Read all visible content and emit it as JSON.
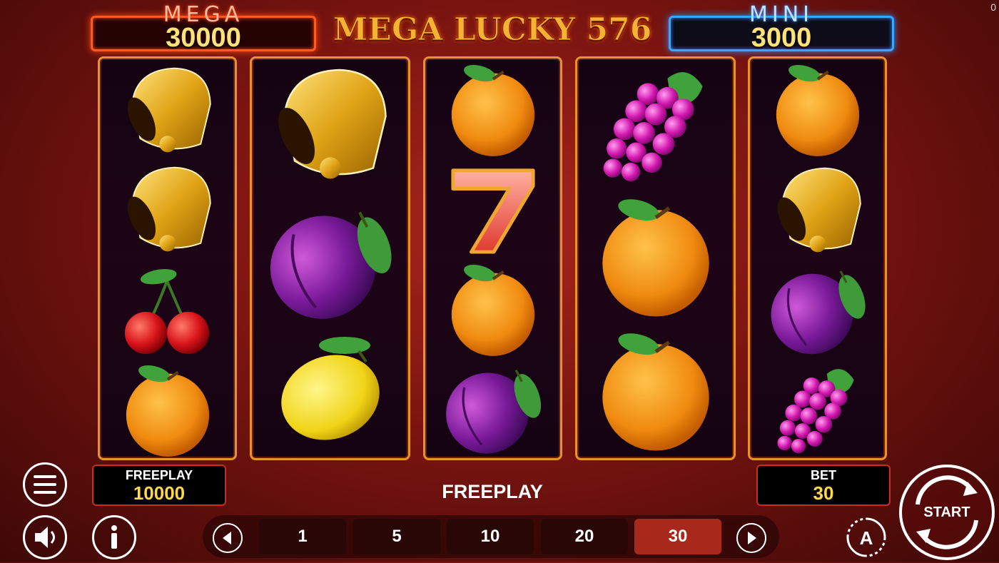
{
  "jackpots": {
    "mega": {
      "label": "MEGA",
      "value": "30000"
    },
    "mini": {
      "label": "MINI",
      "value": "3000"
    }
  },
  "game_title": "MEGA LUCKY 576",
  "corner_counter": "0",
  "reels": [
    [
      "bell-icon",
      "bell-icon",
      "cherry-icon",
      "orange-icon"
    ],
    [
      "bell-icon",
      "plum-icon",
      "lemon-icon"
    ],
    [
      "orange-icon",
      "seven-icon",
      "orange-icon",
      "plum-icon"
    ],
    [
      "grapes-icon",
      "orange-icon",
      "orange-icon"
    ],
    [
      "orange-icon",
      "bell-icon",
      "plum-icon",
      "grapes-icon"
    ]
  ],
  "freeplay_box": {
    "label": "FREEPLAY",
    "value": "10000"
  },
  "bet_box": {
    "label": "BET",
    "value": "30"
  },
  "status_text": "FREEPLAY",
  "bet_options": [
    "1",
    "5",
    "10",
    "20",
    "30"
  ],
  "selected_bet": "30",
  "start_label": "START",
  "colors": {
    "accent_gold": "#ffd84a",
    "reel_border": "#e7932b",
    "mega_glow": "#ff5a1f",
    "mini_glow": "#3aa6ff",
    "selected_bet": "#a8281c"
  }
}
